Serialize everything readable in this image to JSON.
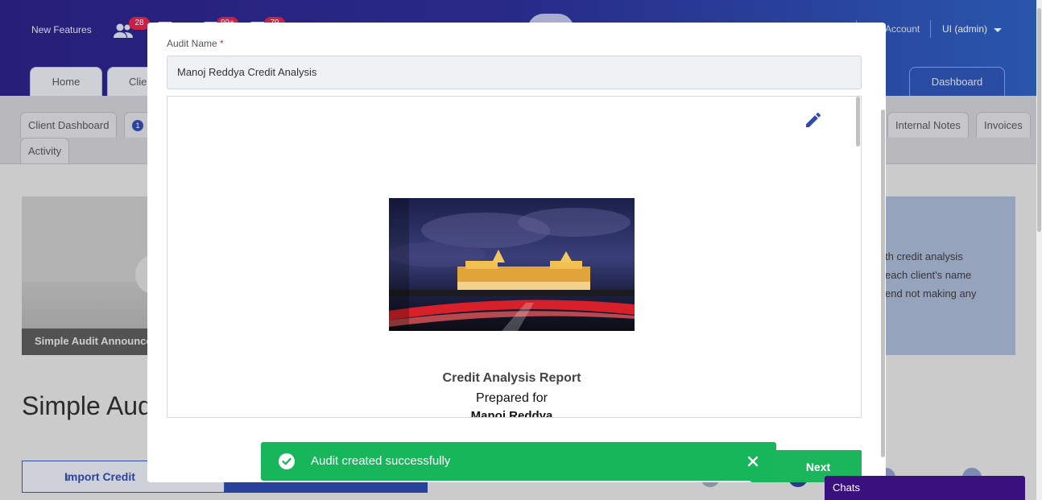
{
  "header": {
    "new_features": "New Features",
    "badges": [
      "28",
      "99+",
      "79"
    ],
    "account_label": "Account",
    "user_label": "UI (admin)"
  },
  "main_tabs": [
    {
      "label": "Home"
    },
    {
      "label": "Clie"
    },
    {
      "label": "Dashboard"
    }
  ],
  "sub_tabs": [
    {
      "label": "Client Dashboard"
    },
    {
      "label": "1"
    },
    {
      "label": "Internal Notes"
    },
    {
      "label": "Invoices"
    },
    {
      "label": "Activity"
    }
  ],
  "background": {
    "card_label": "Simple Audit Announce",
    "card_right_lines": [
      "th credit analysis",
      "each client's name",
      "end not making any"
    ],
    "page_title": "Simple Aud",
    "import_button": "Import Credit"
  },
  "modal": {
    "field_label": "Audit Name",
    "required_mark": "*",
    "audit_name_value": "Manoj Reddya Credit Analysis",
    "report_title": "Credit Analysis Report",
    "prepared_for": "Prepared for",
    "client_name": "Manoj Reddya",
    "next_button": "Next"
  },
  "toast": {
    "message": "Audit created successfully"
  },
  "chats": {
    "label": "Chats"
  },
  "colors": {
    "header_start": "#2a1f86",
    "header_end": "#2c5fc0",
    "toast_green": "#17b65a",
    "next_green": "#1bb55c",
    "edit_blue": "#2f4bb2",
    "chats_purple": "#3a0f7e"
  }
}
